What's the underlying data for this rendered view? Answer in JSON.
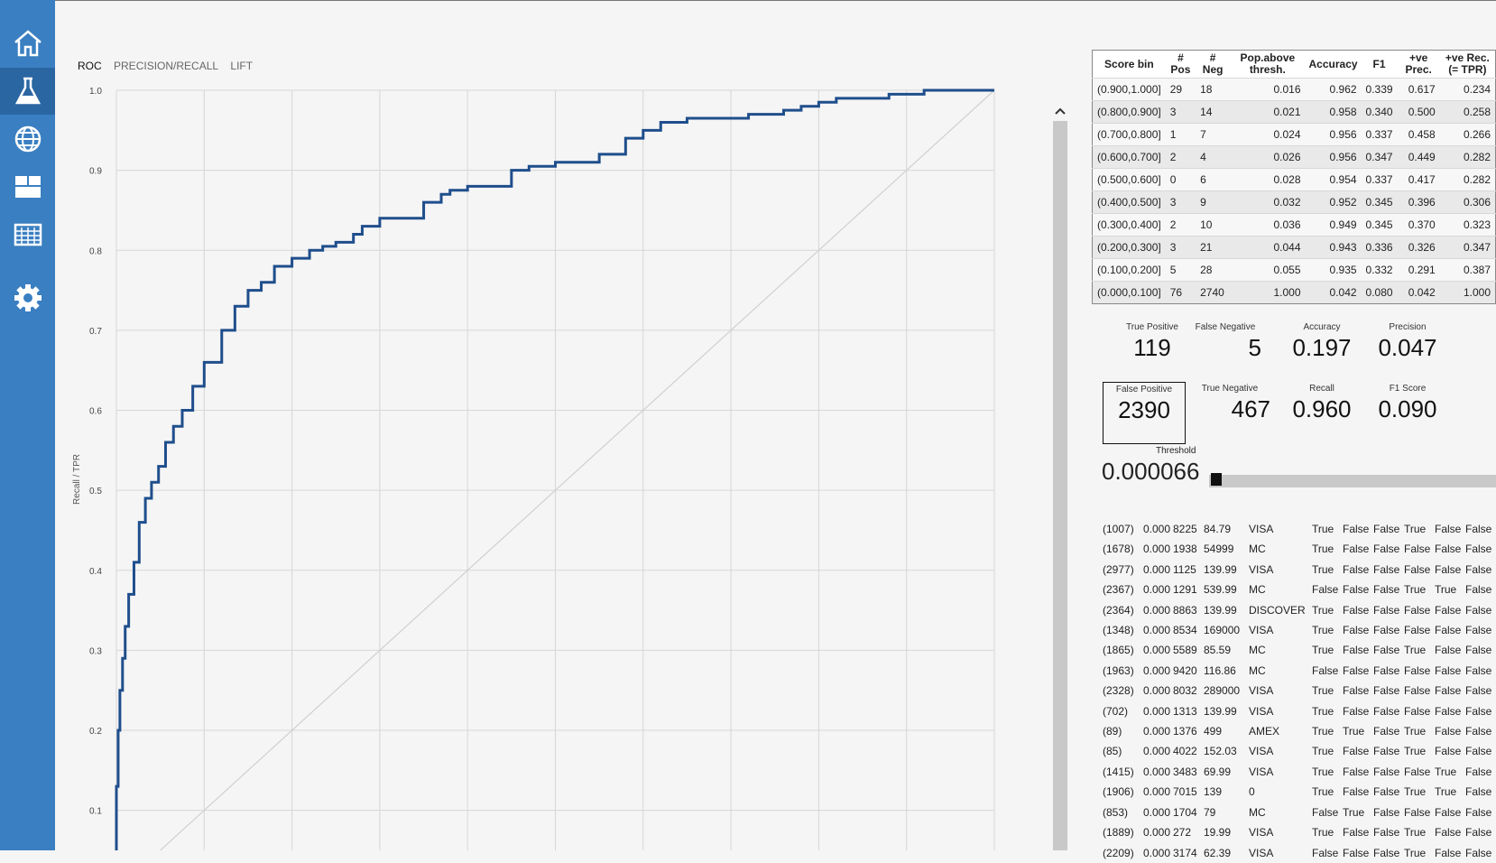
{
  "sidebar": {
    "items": [
      {
        "icon": "home-icon"
      },
      {
        "icon": "flask-icon",
        "active": true
      },
      {
        "icon": "globe-icon"
      },
      {
        "icon": "dashboard-icon"
      },
      {
        "icon": "table-icon"
      },
      {
        "icon": "gear-icon"
      }
    ]
  },
  "tabs": [
    "ROC",
    "PRECISION/RECALL",
    "LIFT"
  ],
  "chart_data": {
    "type": "line",
    "ylabel": "Recall / TPR",
    "ylim": [
      0.05,
      1.0
    ],
    "xlim": [
      0.0,
      1.0
    ],
    "y_ticks": [
      "1.0",
      "0.9",
      "0.8",
      "0.7",
      "0.6",
      "0.5",
      "0.4",
      "0.3",
      "0.2",
      "0.1"
    ],
    "grid": true,
    "color": "#1f4e8c",
    "diagonal_color": "#d0d0d0",
    "series": [
      {
        "x": [
          0.0,
          0.0,
          0.002,
          0.004,
          0.007,
          0.01,
          0.014,
          0.02,
          0.026,
          0.033,
          0.04,
          0.048,
          0.056,
          0.065,
          0.075,
          0.087,
          0.1,
          0.12,
          0.135,
          0.15,
          0.165,
          0.18,
          0.2,
          0.22,
          0.235,
          0.25,
          0.27,
          0.28,
          0.3,
          0.35,
          0.37,
          0.38,
          0.4,
          0.45,
          0.47,
          0.5,
          0.52,
          0.55,
          0.58,
          0.6,
          0.62,
          0.65,
          0.67,
          0.7,
          0.72,
          0.76,
          0.78,
          0.8,
          0.82,
          0.85,
          0.88,
          0.92,
          0.94,
          0.975,
          0.985,
          1.0
        ],
        "y": [
          0.05,
          0.13,
          0.2,
          0.25,
          0.29,
          0.33,
          0.37,
          0.41,
          0.46,
          0.49,
          0.51,
          0.53,
          0.56,
          0.58,
          0.6,
          0.63,
          0.66,
          0.7,
          0.73,
          0.75,
          0.76,
          0.78,
          0.79,
          0.8,
          0.805,
          0.81,
          0.82,
          0.83,
          0.84,
          0.86,
          0.87,
          0.875,
          0.88,
          0.9,
          0.905,
          0.91,
          0.91,
          0.92,
          0.94,
          0.95,
          0.96,
          0.965,
          0.965,
          0.965,
          0.97,
          0.975,
          0.98,
          0.985,
          0.99,
          0.99,
          0.995,
          1.0,
          1.0,
          1.0,
          1.0,
          1.0
        ]
      }
    ]
  },
  "bins": {
    "headers": [
      "Score bin",
      "# Pos",
      "# Neg",
      "Pop.above thresh.",
      "Accuracy",
      "F1",
      "+ve Prec.",
      "+ve Rec. (= TPR)"
    ],
    "rows": [
      [
        "(0.900,1.000]",
        "29",
        "18",
        "0.016",
        "0.962",
        "0.339",
        "0.617",
        "0.234"
      ],
      [
        "(0.800,0.900]",
        "3",
        "14",
        "0.021",
        "0.958",
        "0.340",
        "0.500",
        "0.258"
      ],
      [
        "(0.700,0.800]",
        "1",
        "7",
        "0.024",
        "0.956",
        "0.337",
        "0.458",
        "0.266"
      ],
      [
        "(0.600,0.700]",
        "2",
        "4",
        "0.026",
        "0.956",
        "0.347",
        "0.449",
        "0.282"
      ],
      [
        "(0.500,0.600]",
        "0",
        "6",
        "0.028",
        "0.954",
        "0.337",
        "0.417",
        "0.282"
      ],
      [
        "(0.400,0.500]",
        "3",
        "9",
        "0.032",
        "0.952",
        "0.345",
        "0.396",
        "0.306"
      ],
      [
        "(0.300,0.400]",
        "2",
        "10",
        "0.036",
        "0.949",
        "0.345",
        "0.370",
        "0.323"
      ],
      [
        "(0.200,0.300]",
        "3",
        "21",
        "0.044",
        "0.943",
        "0.336",
        "0.326",
        "0.347"
      ],
      [
        "(0.100,0.200]",
        "5",
        "28",
        "0.055",
        "0.935",
        "0.332",
        "0.291",
        "0.387"
      ],
      [
        "(0.000,0.100]",
        "76",
        "2740",
        "1.000",
        "0.042",
        "0.080",
        "0.042",
        "1.000"
      ]
    ]
  },
  "metrics": {
    "tp_label": "True Positive",
    "tp": "119",
    "fn_label": "False Negative",
    "fn": "5",
    "acc_label": "Accuracy",
    "acc": "0.197",
    "prec_label": "Precision",
    "prec": "0.047",
    "fp_label": "False Positive",
    "fp": "2390",
    "tn_label": "True Negative",
    "tn": "467",
    "rec_label": "Recall",
    "rec": "0.960",
    "f1_label": "F1 Score",
    "f1": "0.090"
  },
  "threshold": {
    "label": "Threshold",
    "value": "0.000066",
    "slider_position": 0.0
  },
  "records": [
    [
      "(1007)",
      "0.000",
      "8225",
      "84.79",
      "VISA",
      "True",
      "False",
      "False",
      "True",
      "False",
      "False"
    ],
    [
      "(1678)",
      "0.000",
      "1938",
      "54999",
      "MC",
      "True",
      "False",
      "False",
      "False",
      "False",
      "False"
    ],
    [
      "(2977)",
      "0.000",
      "1125",
      "139.99",
      "VISA",
      "True",
      "False",
      "False",
      "False",
      "False",
      "False"
    ],
    [
      "(2367)",
      "0.000",
      "1291",
      "539.99",
      "MC",
      "False",
      "False",
      "False",
      "True",
      "True",
      "False"
    ],
    [
      "(2364)",
      "0.000",
      "8863",
      "139.99",
      "DISCOVER",
      "True",
      "False",
      "False",
      "False",
      "False",
      "False"
    ],
    [
      "(1348)",
      "0.000",
      "8534",
      "169000",
      "VISA",
      "True",
      "False",
      "False",
      "False",
      "False",
      "False"
    ],
    [
      "(1865)",
      "0.000",
      "5589",
      "85.59",
      "MC",
      "True",
      "False",
      "False",
      "True",
      "False",
      "False"
    ],
    [
      "(1963)",
      "0.000",
      "9420",
      "116.86",
      "MC",
      "False",
      "False",
      "False",
      "False",
      "False",
      "False"
    ],
    [
      "(2328)",
      "0.000",
      "8032",
      "289000",
      "VISA",
      "True",
      "False",
      "False",
      "False",
      "False",
      "False"
    ],
    [
      "(702)",
      "0.000",
      "1313",
      "139.99",
      "VISA",
      "True",
      "False",
      "False",
      "False",
      "False",
      "False"
    ],
    [
      "(89)",
      "0.000",
      "1376",
      "499",
      "AMEX",
      "True",
      "True",
      "False",
      "True",
      "False",
      "False"
    ],
    [
      "(85)",
      "0.000",
      "4022",
      "152.03",
      "VISA",
      "True",
      "False",
      "False",
      "True",
      "False",
      "False"
    ],
    [
      "(1415)",
      "0.000",
      "3483",
      "69.99",
      "VISA",
      "True",
      "False",
      "False",
      "False",
      "True",
      "False"
    ],
    [
      "(1906)",
      "0.000",
      "7015",
      "139",
      "0",
      "True",
      "False",
      "False",
      "True",
      "True",
      "False"
    ],
    [
      "(853)",
      "0.000",
      "1704",
      "79",
      "MC",
      "False",
      "True",
      "False",
      "False",
      "False",
      "False"
    ],
    [
      "(1889)",
      "0.000",
      "272",
      "19.99",
      "VISA",
      "True",
      "False",
      "False",
      "True",
      "False",
      "False"
    ],
    [
      "(2209)",
      "0.000",
      "3174",
      "62.39",
      "VISA",
      "False",
      "False",
      "False",
      "True",
      "False",
      "False"
    ]
  ]
}
